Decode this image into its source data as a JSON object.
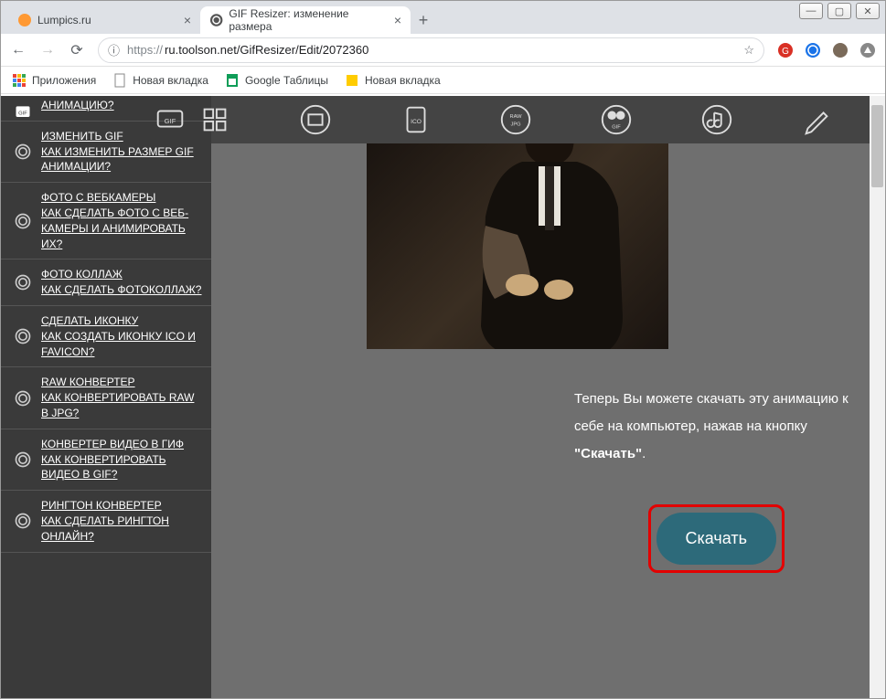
{
  "window": {
    "tabs": [
      {
        "title": "Lumpics.ru",
        "active": false
      },
      {
        "title": "GIF Resizer: изменение размера",
        "active": true
      }
    ]
  },
  "addressbar": {
    "protocol": "https://",
    "url": "ru.toolson.net/GifResizer/Edit/2072360"
  },
  "bookmarks": {
    "apps": "Приложения",
    "items": [
      "Новая вкладка",
      "Google Таблицы",
      "Новая вкладка"
    ]
  },
  "sidebar": {
    "items": [
      {
        "title": "",
        "desc": "АНИМАЦИЮ?"
      },
      {
        "title": "ИЗМЕНИТЬ GIF",
        "desc": "КАК ИЗМЕНИТЬ РАЗМЕР GIF АНИМАЦИИ?"
      },
      {
        "title": "ФОТО С ВЕБКАМЕРЫ",
        "desc": "КАК СДЕЛАТЬ ФОТО С ВЕБ-КАМЕРЫ И АНИМИРОВАТЬ ИХ?"
      },
      {
        "title": "ФОТО КОЛЛАЖ",
        "desc": "КАК СДЕЛАТЬ ФОТОКОЛЛАЖ?"
      },
      {
        "title": "СДЕЛАТЬ ИКОНКУ",
        "desc": "КАК СОЗДАТЬ ИКОНКУ ICO И FAVICON?"
      },
      {
        "title": "RAW КОНВЕРТЕР",
        "desc": "КАК КОНВЕРТИРОВАТЬ RAW В JPG?"
      },
      {
        "title": "КОНВЕРТЕР ВИДЕО В ГИФ",
        "desc": "КАК КОНВЕРТИРОВАТЬ ВИДЕО В GIF?"
      },
      {
        "title": "РИНГТОН КОНВЕРТЕР",
        "desc": "КАК СДЕЛАТЬ РИНГТОН ОНЛАЙН?"
      }
    ]
  },
  "toolbar_icons": [
    "gif-icon",
    "grid-icon",
    "camera-icon",
    "ico-icon",
    "raw-jpg-icon",
    "video-gif-icon",
    "music-icon",
    "pencil-icon"
  ],
  "download": {
    "text_part1": "Теперь Вы можете скачать эту анимацию к себе на компьютер, нажав на кнопку ",
    "text_bold": "\"Скачать\"",
    "text_part2": ".",
    "button": "Скачать"
  }
}
